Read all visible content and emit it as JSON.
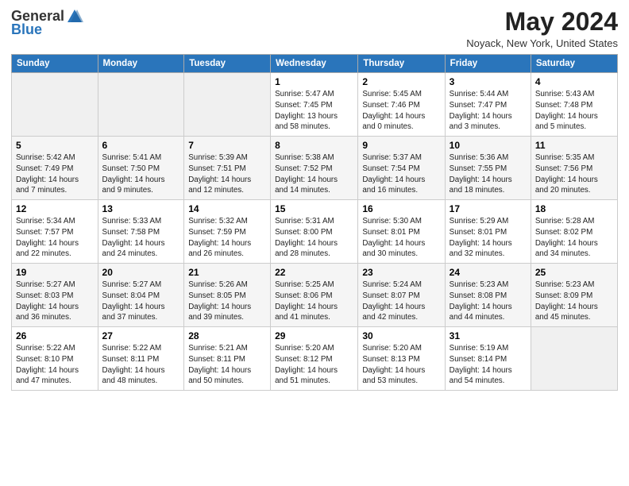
{
  "app": {
    "logo_general": "General",
    "logo_blue": "Blue",
    "month": "May 2024",
    "location": "Noyack, New York, United States"
  },
  "calendar": {
    "headers": [
      "Sunday",
      "Monday",
      "Tuesday",
      "Wednesday",
      "Thursday",
      "Friday",
      "Saturday"
    ],
    "weeks": [
      [
        {
          "day": "",
          "info": ""
        },
        {
          "day": "",
          "info": ""
        },
        {
          "day": "",
          "info": ""
        },
        {
          "day": "1",
          "info": "Sunrise: 5:47 AM\nSunset: 7:45 PM\nDaylight: 13 hours\nand 58 minutes."
        },
        {
          "day": "2",
          "info": "Sunrise: 5:45 AM\nSunset: 7:46 PM\nDaylight: 14 hours\nand 0 minutes."
        },
        {
          "day": "3",
          "info": "Sunrise: 5:44 AM\nSunset: 7:47 PM\nDaylight: 14 hours\nand 3 minutes."
        },
        {
          "day": "4",
          "info": "Sunrise: 5:43 AM\nSunset: 7:48 PM\nDaylight: 14 hours\nand 5 minutes."
        }
      ],
      [
        {
          "day": "5",
          "info": "Sunrise: 5:42 AM\nSunset: 7:49 PM\nDaylight: 14 hours\nand 7 minutes."
        },
        {
          "day": "6",
          "info": "Sunrise: 5:41 AM\nSunset: 7:50 PM\nDaylight: 14 hours\nand 9 minutes."
        },
        {
          "day": "7",
          "info": "Sunrise: 5:39 AM\nSunset: 7:51 PM\nDaylight: 14 hours\nand 12 minutes."
        },
        {
          "day": "8",
          "info": "Sunrise: 5:38 AM\nSunset: 7:52 PM\nDaylight: 14 hours\nand 14 minutes."
        },
        {
          "day": "9",
          "info": "Sunrise: 5:37 AM\nSunset: 7:54 PM\nDaylight: 14 hours\nand 16 minutes."
        },
        {
          "day": "10",
          "info": "Sunrise: 5:36 AM\nSunset: 7:55 PM\nDaylight: 14 hours\nand 18 minutes."
        },
        {
          "day": "11",
          "info": "Sunrise: 5:35 AM\nSunset: 7:56 PM\nDaylight: 14 hours\nand 20 minutes."
        }
      ],
      [
        {
          "day": "12",
          "info": "Sunrise: 5:34 AM\nSunset: 7:57 PM\nDaylight: 14 hours\nand 22 minutes."
        },
        {
          "day": "13",
          "info": "Sunrise: 5:33 AM\nSunset: 7:58 PM\nDaylight: 14 hours\nand 24 minutes."
        },
        {
          "day": "14",
          "info": "Sunrise: 5:32 AM\nSunset: 7:59 PM\nDaylight: 14 hours\nand 26 minutes."
        },
        {
          "day": "15",
          "info": "Sunrise: 5:31 AM\nSunset: 8:00 PM\nDaylight: 14 hours\nand 28 minutes."
        },
        {
          "day": "16",
          "info": "Sunrise: 5:30 AM\nSunset: 8:01 PM\nDaylight: 14 hours\nand 30 minutes."
        },
        {
          "day": "17",
          "info": "Sunrise: 5:29 AM\nSunset: 8:01 PM\nDaylight: 14 hours\nand 32 minutes."
        },
        {
          "day": "18",
          "info": "Sunrise: 5:28 AM\nSunset: 8:02 PM\nDaylight: 14 hours\nand 34 minutes."
        }
      ],
      [
        {
          "day": "19",
          "info": "Sunrise: 5:27 AM\nSunset: 8:03 PM\nDaylight: 14 hours\nand 36 minutes."
        },
        {
          "day": "20",
          "info": "Sunrise: 5:27 AM\nSunset: 8:04 PM\nDaylight: 14 hours\nand 37 minutes."
        },
        {
          "day": "21",
          "info": "Sunrise: 5:26 AM\nSunset: 8:05 PM\nDaylight: 14 hours\nand 39 minutes."
        },
        {
          "day": "22",
          "info": "Sunrise: 5:25 AM\nSunset: 8:06 PM\nDaylight: 14 hours\nand 41 minutes."
        },
        {
          "day": "23",
          "info": "Sunrise: 5:24 AM\nSunset: 8:07 PM\nDaylight: 14 hours\nand 42 minutes."
        },
        {
          "day": "24",
          "info": "Sunrise: 5:23 AM\nSunset: 8:08 PM\nDaylight: 14 hours\nand 44 minutes."
        },
        {
          "day": "25",
          "info": "Sunrise: 5:23 AM\nSunset: 8:09 PM\nDaylight: 14 hours\nand 45 minutes."
        }
      ],
      [
        {
          "day": "26",
          "info": "Sunrise: 5:22 AM\nSunset: 8:10 PM\nDaylight: 14 hours\nand 47 minutes."
        },
        {
          "day": "27",
          "info": "Sunrise: 5:22 AM\nSunset: 8:11 PM\nDaylight: 14 hours\nand 48 minutes."
        },
        {
          "day": "28",
          "info": "Sunrise: 5:21 AM\nSunset: 8:11 PM\nDaylight: 14 hours\nand 50 minutes."
        },
        {
          "day": "29",
          "info": "Sunrise: 5:20 AM\nSunset: 8:12 PM\nDaylight: 14 hours\nand 51 minutes."
        },
        {
          "day": "30",
          "info": "Sunrise: 5:20 AM\nSunset: 8:13 PM\nDaylight: 14 hours\nand 53 minutes."
        },
        {
          "day": "31",
          "info": "Sunrise: 5:19 AM\nSunset: 8:14 PM\nDaylight: 14 hours\nand 54 minutes."
        },
        {
          "day": "",
          "info": ""
        }
      ]
    ]
  }
}
